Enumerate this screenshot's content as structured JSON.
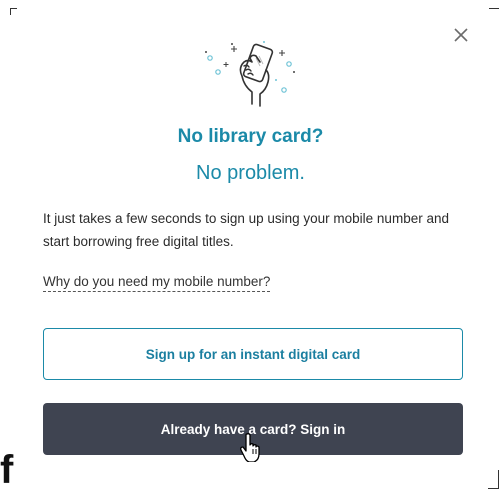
{
  "background": {
    "letter": "f"
  },
  "dialog": {
    "close_icon": "close-icon",
    "hero_icon": "hand-holding-phone-icon",
    "title_line1": "No library card?",
    "title_line2": "No problem.",
    "body": "It just takes a few seconds to sign up using your mobile number and start borrowing free digital titles.",
    "why_link": "Why do you need my mobile number?",
    "signup_button": "Sign up for an instant digital card",
    "signin_button": "Already have a card? Sign in"
  },
  "colors": {
    "accent": "#1b8aa8",
    "dark_button": "#3f4451"
  }
}
